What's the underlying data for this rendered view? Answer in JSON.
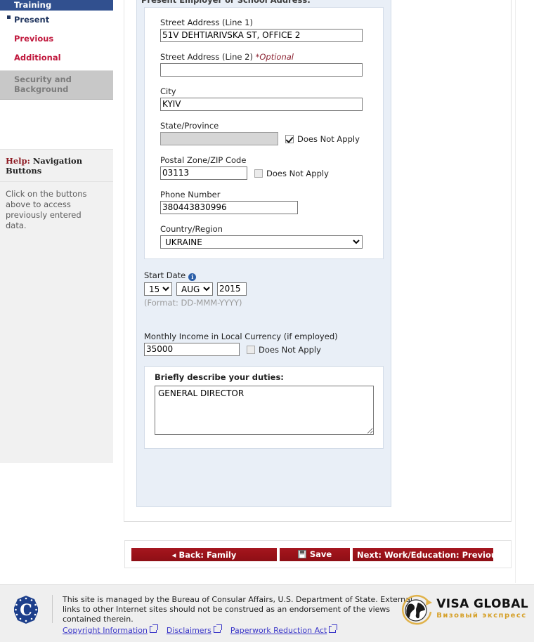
{
  "sidebar": {
    "active_tab": "Training",
    "items": [
      {
        "label": "Present",
        "state": "current"
      },
      {
        "label": "Previous",
        "state": "link"
      },
      {
        "label": "Additional",
        "state": "link"
      },
      {
        "label": "Security and Background",
        "state": "disabled"
      }
    ],
    "help": {
      "title_highlight": "Help:",
      "title_rest": "Navigation Buttons",
      "body": "Click on the buttons above to access previously entered data."
    }
  },
  "form": {
    "section_title": "Present Employer or School Address:",
    "street1": {
      "label": "Street Address (Line 1)",
      "value": "51V DEHTIARIVSKA ST, OFFICE 2"
    },
    "street2": {
      "label": "Street Address (Line 2)",
      "optional_tag": "*Optional",
      "value": ""
    },
    "city": {
      "label": "City",
      "value": "KYIV"
    },
    "state": {
      "label": "State/Province",
      "value": "",
      "does_not_apply_label": "Does Not Apply",
      "checked": true
    },
    "postal": {
      "label": "Postal Zone/ZIP Code",
      "value": "03113",
      "does_not_apply_label": "Does Not Apply",
      "checked": false
    },
    "phone": {
      "label": "Phone Number",
      "value": "380443830996"
    },
    "country": {
      "label": "Country/Region",
      "value": "UKRAINE",
      "options": [
        "UKRAINE"
      ]
    },
    "start_date": {
      "label": "Start Date",
      "day": "15",
      "month": "AUG",
      "year": "2015",
      "day_options": [
        "15"
      ],
      "month_options": [
        "AUG"
      ],
      "format_hint": "(Format: DD-MMM-YYYY)"
    },
    "income": {
      "label": "Monthly Income in Local Currency (if employed)",
      "value": "35000",
      "does_not_apply_label": "Does Not Apply",
      "checked": false
    },
    "duties": {
      "label": "Briefly describe your duties:",
      "value": "GENERAL DIRECTOR"
    }
  },
  "buttons": {
    "back": "Back: Family",
    "save": "Save",
    "next": "Next: Work/Education: Previous"
  },
  "footer": {
    "text": "This site is managed by the Bureau of Consular Affairs, U.S. Department of State. External links to other Internet sites should not be construed as an endorsement of the views contained therein.",
    "links": [
      {
        "label": "Copyright Information"
      },
      {
        "label": "Disclaimers"
      },
      {
        "label": "Paperwork Reduction Act"
      }
    ],
    "logo": {
      "main": "VISA GLOBAL",
      "sub": "Визовый экспресс"
    }
  },
  "colors": {
    "nav_active": "#31508f",
    "nav_link": "#c0173c",
    "button_red": "#9c1219",
    "panel_blue": "#e9eff7",
    "link_blue": "#3a36c8",
    "logo_gold": "#d6a028"
  }
}
